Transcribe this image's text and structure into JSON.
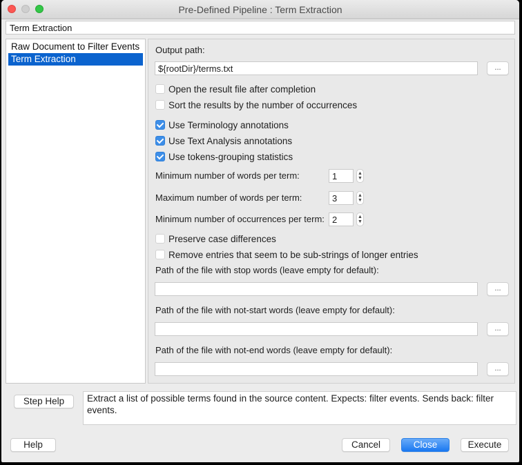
{
  "window": {
    "title": "Pre-Defined Pipeline : Term Extraction",
    "controls": [
      "close",
      "minimize",
      "maximize"
    ]
  },
  "pipeline_name": "Term Extraction",
  "steps": [
    {
      "label": "Raw Document to Filter Events",
      "selected": false
    },
    {
      "label": "Term Extraction",
      "selected": true
    }
  ],
  "panel": {
    "output_path_label": "Output path:",
    "output_path_value": "${rootDir}/terms.txt",
    "browse_label": "...",
    "checkboxes": [
      {
        "label": "Open the result file after completion",
        "checked": false
      },
      {
        "label": "Sort the results by the number of occurrences",
        "checked": false
      },
      {
        "label": "Use Terminology annotations",
        "checked": true
      },
      {
        "label": "Use Text Analysis annotations",
        "checked": true
      },
      {
        "label": "Use tokens-grouping statistics",
        "checked": true
      }
    ],
    "spinners": [
      {
        "label": "Minimum number of words per term:",
        "value": "1"
      },
      {
        "label": "Maximum number of words per term:",
        "value": "3"
      },
      {
        "label": "Minimum number of occurrences per term:",
        "value": "2"
      }
    ],
    "checkboxes2": [
      {
        "label": "Preserve case differences",
        "checked": false
      },
      {
        "label": "Remove entries that seem to be sub-strings of longer entries",
        "checked": false
      }
    ],
    "stop_words_label": "Path of the file with stop words (leave empty for default):",
    "stop_words_value": "",
    "not_start_label": "Path of the file with not-start words (leave empty for default):",
    "not_start_value": "",
    "not_end_label": "Path of the file with not-end words (leave empty for default):",
    "not_end_value": ""
  },
  "step_help": {
    "button_label": "Step Help",
    "description": "Extract a list of possible terms found in the source content. Expects: filter events. Sends back: filter events."
  },
  "footer": {
    "help_label": "Help",
    "cancel_label": "Cancel",
    "close_label": "Close",
    "execute_label": "Execute"
  },
  "colors": {
    "selection": "#0b63ce",
    "checkbox_checked": "#3d8ee8",
    "primary_button": "#1a78f1"
  }
}
